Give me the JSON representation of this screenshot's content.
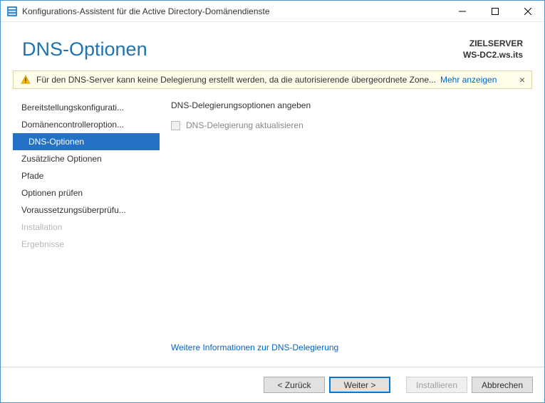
{
  "window": {
    "title": "Konfigurations-Assistent für die Active Directory-Domänendienste"
  },
  "header": {
    "page_title": "DNS-Optionen",
    "target_label": "ZIELSERVER",
    "target_server": "WS-DC2.ws.its"
  },
  "notice": {
    "text": "Für den DNS-Server kann keine Delegierung erstellt werden, da die autorisierende übergeordnete Zone...",
    "show_more": "Mehr anzeigen"
  },
  "sidebar": {
    "items": [
      {
        "label": "Bereitstellungskonfigurati...",
        "state": "normal"
      },
      {
        "label": "Domänencontrolleroption...",
        "state": "normal"
      },
      {
        "label": "DNS-Optionen",
        "state": "active"
      },
      {
        "label": "Zusätzliche Optionen",
        "state": "normal"
      },
      {
        "label": "Pfade",
        "state": "normal"
      },
      {
        "label": "Optionen prüfen",
        "state": "normal"
      },
      {
        "label": "Voraussetzungsüberprüfu...",
        "state": "normal"
      },
      {
        "label": "Installation",
        "state": "disabled"
      },
      {
        "label": "Ergebnisse",
        "state": "disabled"
      }
    ]
  },
  "main": {
    "section_heading": "DNS-Delegierungsoptionen angeben",
    "checkbox_label": "DNS-Delegierung aktualisieren",
    "checkbox_checked": false,
    "checkbox_enabled": false,
    "more_info_link": "Weitere Informationen zur DNS-Delegierung"
  },
  "buttons": {
    "back": "< Zurück",
    "next": "Weiter >",
    "install": "Installieren",
    "cancel": "Abbrechen"
  }
}
